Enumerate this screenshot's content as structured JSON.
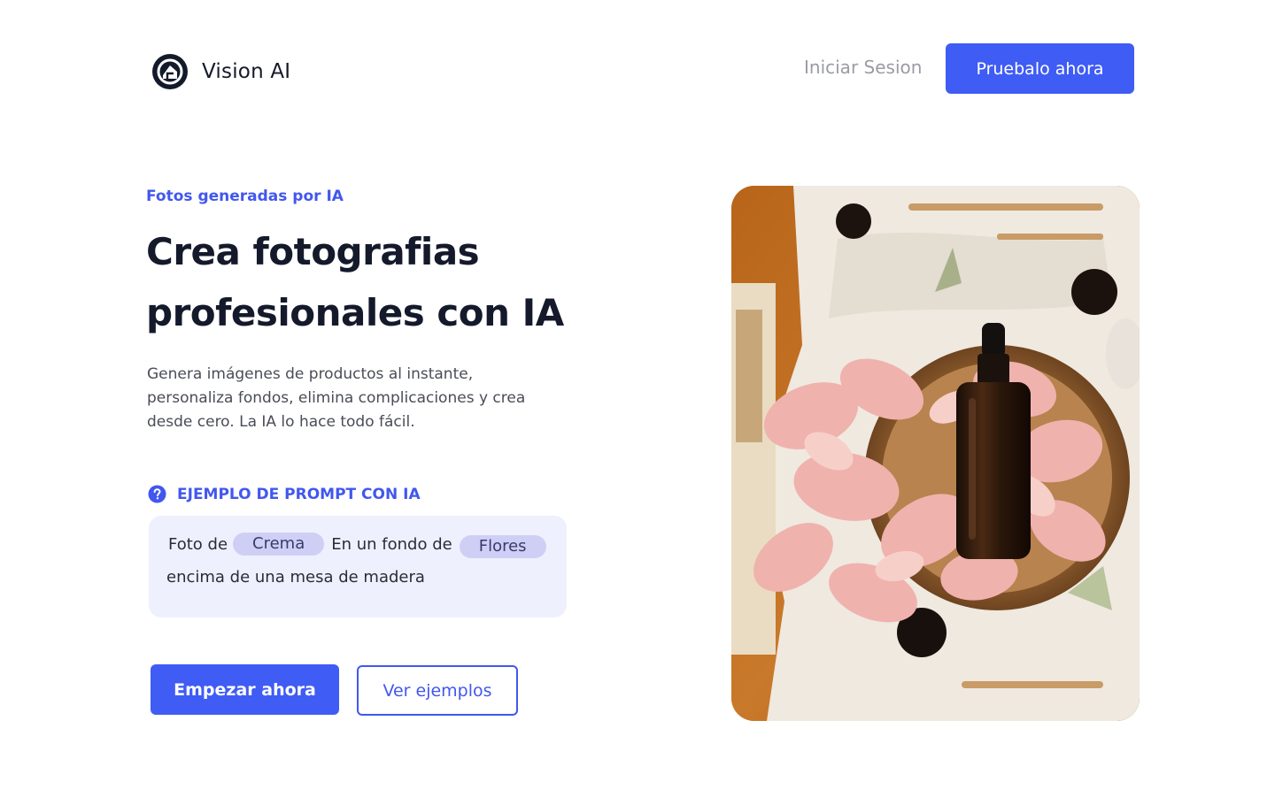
{
  "header": {
    "brand_name": "Vision AI",
    "login_label": "Iniciar Sesion",
    "try_label": "Pruebalo ahora"
  },
  "hero": {
    "eyebrow": "Fotos generadas por IA",
    "title": "Crea fotografias profesionales con IA",
    "description": "Genera imágenes de productos al instante, personaliza fondos, elimina complicaciones y crea desde cero. La IA lo hace todo fácil."
  },
  "prompt": {
    "label": "EJEMPLO DE PROMPT CON IA",
    "text_1": "Foto de",
    "chip_product": "Crema",
    "text_2": "En un fondo de",
    "chip_background": "Flores",
    "text_3": "encima de una mesa de madera"
  },
  "cta": {
    "start_label": "Empezar ahora",
    "examples_label": "Ver ejemplos"
  },
  "colors": {
    "accent": "#3f5cf5",
    "text_dark": "#141a2b",
    "muted": "#9a9ca3",
    "prompt_bg": "#eef0fd",
    "chip_bg": "#cfcff6"
  },
  "icons": {
    "logo": "camera-aperture-logo",
    "prompt_help": "question-circle-icon"
  }
}
